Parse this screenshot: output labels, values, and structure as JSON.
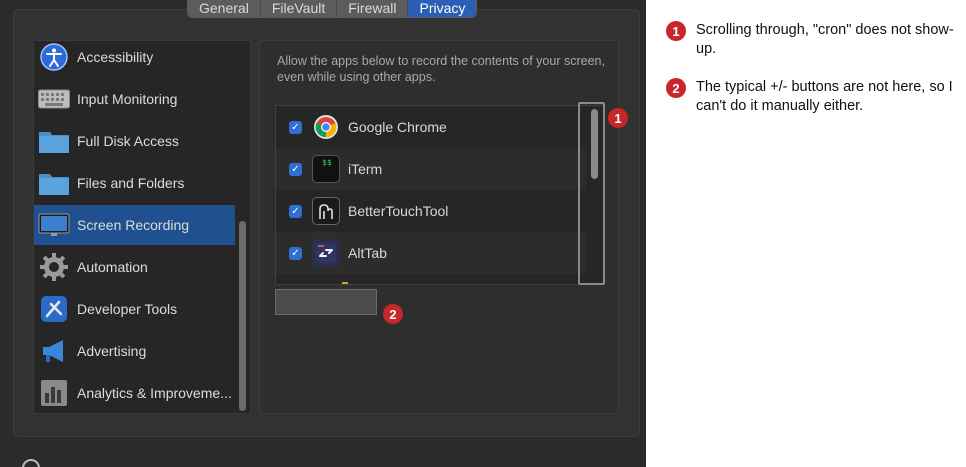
{
  "tabs": [
    "General",
    "FileVault",
    "Firewall",
    "Privacy"
  ],
  "sidebar": {
    "items": [
      {
        "label": "Accessibility",
        "icon": "accessibility-icon"
      },
      {
        "label": "Input Monitoring",
        "icon": "keyboard-icon"
      },
      {
        "label": "Full Disk Access",
        "icon": "folder-icon"
      },
      {
        "label": "Files and Folders",
        "icon": "folder-icon"
      },
      {
        "label": "Screen Recording",
        "icon": "display-icon",
        "selected": true
      },
      {
        "label": "Automation",
        "icon": "gear-icon"
      },
      {
        "label": "Developer Tools",
        "icon": "developer-tools-icon"
      },
      {
        "label": "Advertising",
        "icon": "megaphone-icon"
      },
      {
        "label": "Analytics & Improveme...",
        "icon": "bar-chart-icon"
      }
    ]
  },
  "main": {
    "description": "Allow the apps below to record the contents of your screen, even while using other apps.",
    "apps": [
      {
        "name": "Google Chrome",
        "checked": true,
        "icon": "chrome-icon"
      },
      {
        "name": "iTerm",
        "checked": true,
        "icon": "terminal-icon"
      },
      {
        "name": "BetterTouchTool",
        "checked": true,
        "icon": "bettertouchtool-icon"
      },
      {
        "name": "AltTab",
        "checked": true,
        "icon": "alttab-icon"
      }
    ]
  },
  "annotations": [
    {
      "number": "1",
      "text": "Scrolling through, \"cron\" does not show-up."
    },
    {
      "number": "2",
      "text": "The typical +/- buttons are not here, so I can't do it manually either."
    }
  ],
  "colors": {
    "accent": "#2a5fb4",
    "checkbox": "#2f6fd1",
    "badge": "#c8262a"
  }
}
